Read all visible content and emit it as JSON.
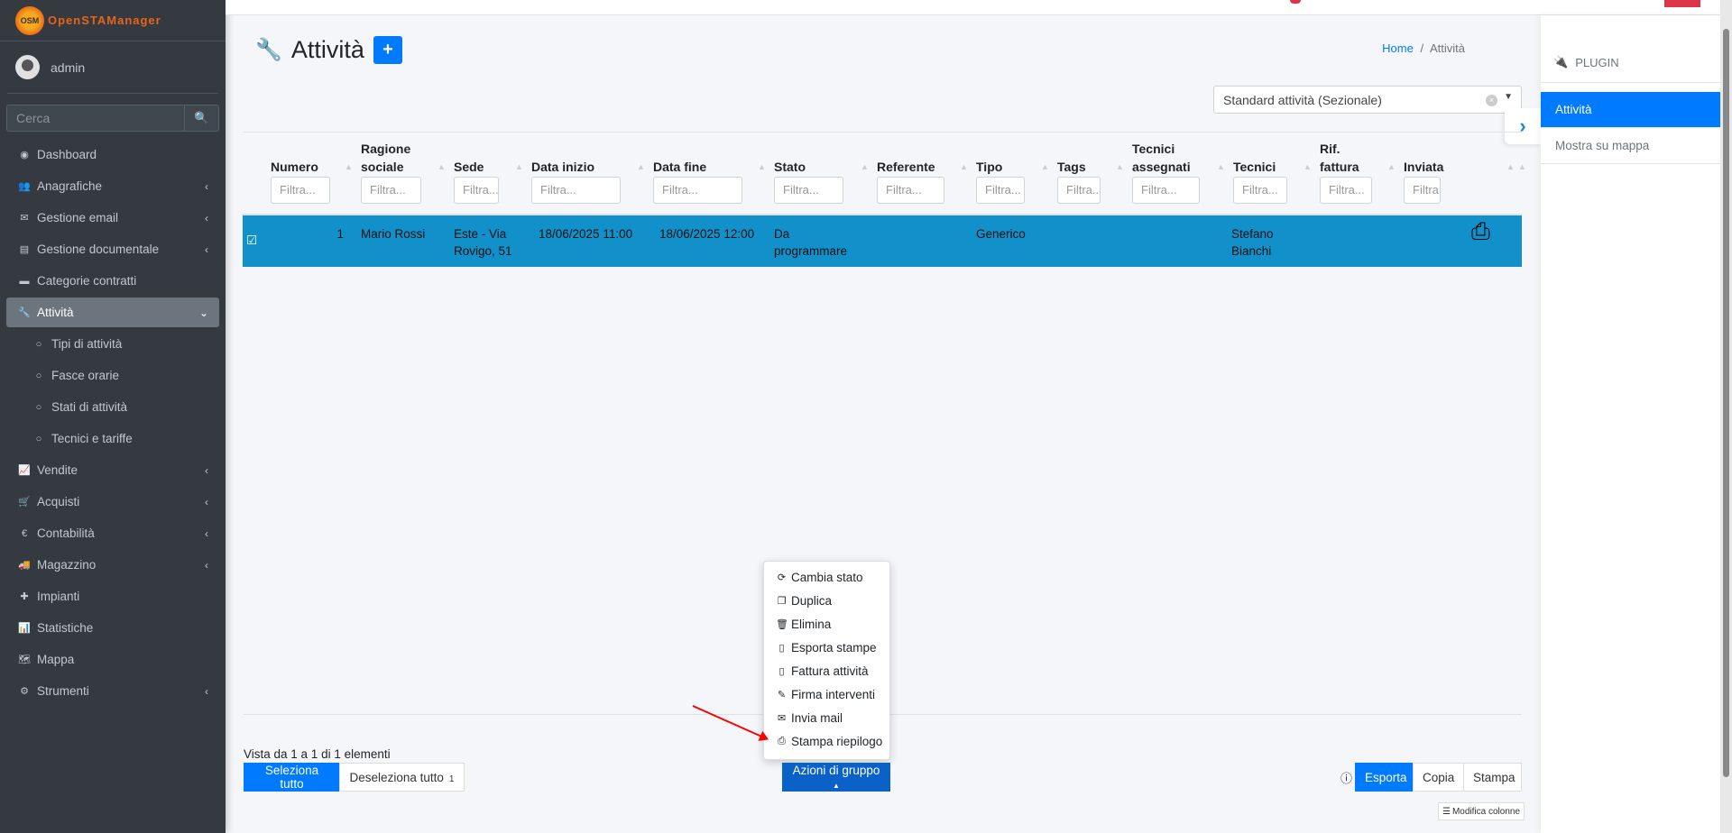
{
  "brand": {
    "name": "OpenSTAManager",
    "logo_text": "OSM"
  },
  "user": {
    "name": "admin"
  },
  "search": {
    "placeholder": "Cerca"
  },
  "sidebar": {
    "items": [
      {
        "label": "Dashboard",
        "icon": "dashboard-icon",
        "glyph": "◉",
        "arrow": false
      },
      {
        "label": "Anagrafiche",
        "icon": "users-icon",
        "glyph": "👥",
        "arrow": true
      },
      {
        "label": "Gestione email",
        "icon": "envelope-icon",
        "glyph": "✉",
        "arrow": true
      },
      {
        "label": "Gestione documentale",
        "icon": "file-icon",
        "glyph": "▤",
        "arrow": true
      },
      {
        "label": "Categorie contratti",
        "icon": "briefcase-icon",
        "glyph": "▬",
        "arrow": false
      },
      {
        "label": "Attività",
        "icon": "wrench-icon",
        "glyph": "🔧",
        "arrow": true,
        "active": true
      },
      {
        "label": "Tipi di attività",
        "icon": "circle-icon",
        "glyph": "○",
        "sub": true
      },
      {
        "label": "Fasce orarie",
        "icon": "circle-icon",
        "glyph": "○",
        "sub": true
      },
      {
        "label": "Stati di attività",
        "icon": "circle-icon",
        "glyph": "○",
        "sub": true
      },
      {
        "label": "Tecnici e tariffe",
        "icon": "circle-icon",
        "glyph": "○",
        "sub": true
      },
      {
        "label": "Vendite",
        "icon": "chart-line-icon",
        "glyph": "📈",
        "arrow": true
      },
      {
        "label": "Acquisti",
        "icon": "cart-icon",
        "glyph": "🛒",
        "arrow": true
      },
      {
        "label": "Contabilità",
        "icon": "euro-icon",
        "glyph": "€",
        "arrow": true
      },
      {
        "label": "Magazzino",
        "icon": "truck-icon",
        "glyph": "🚚",
        "arrow": true
      },
      {
        "label": "Impianti",
        "icon": "puzzle-icon",
        "glyph": "✚",
        "arrow": false
      },
      {
        "label": "Statistiche",
        "icon": "bar-chart-icon",
        "glyph": "📊",
        "arrow": false
      },
      {
        "label": "Mappa",
        "icon": "map-icon",
        "glyph": "🗺",
        "arrow": false
      },
      {
        "label": "Strumenti",
        "icon": "cog-icon",
        "glyph": "⚙",
        "arrow": true
      }
    ]
  },
  "page": {
    "title": "Attività",
    "add_label": "+"
  },
  "breadcrumb": {
    "home": "Home",
    "separator": "/",
    "current": "Attività"
  },
  "segment_select": {
    "value": "Standard attività (Sezionale)"
  },
  "table": {
    "filter_placeholder": "Filtra...",
    "columns": [
      {
        "l1": "",
        "l2": "Numero"
      },
      {
        "l1": "Ragione",
        "l2": "sociale"
      },
      {
        "l1": "",
        "l2": "Sede"
      },
      {
        "l1": "",
        "l2": "Data inizio"
      },
      {
        "l1": "",
        "l2": "Data fine"
      },
      {
        "l1": "",
        "l2": "Stato"
      },
      {
        "l1": "",
        "l2": "Referente"
      },
      {
        "l1": "",
        "l2": "Tipo"
      },
      {
        "l1": "",
        "l2": "Tags"
      },
      {
        "l1": "Tecnici",
        "l2": "assegnati"
      },
      {
        "l1": "",
        "l2": "Tecnici"
      },
      {
        "l1": "Rif.",
        "l2": "fattura"
      },
      {
        "l1": "",
        "l2": "Inviata"
      }
    ],
    "rows": [
      {
        "selected": true,
        "numero": "1",
        "ragione_sociale": "Mario Rossi",
        "sede": "Este - Via Rovigo, 51",
        "data_inizio": "18/06/2025 11:00",
        "data_fine": "18/06/2025 12:00",
        "stato": "Da programmare",
        "referente": "",
        "tipo": "Generico",
        "tags": "",
        "tecnici_assegnati": "",
        "tecnici": "Stefano Bianchi",
        "rif_fattura": "",
        "inviata": ""
      }
    ]
  },
  "right_panel": {
    "header": "PLUGIN",
    "items": [
      {
        "label": "Attività",
        "active": true
      },
      {
        "label": "Mostra su mappa"
      }
    ]
  },
  "group_actions": {
    "button": "Azioni di gruppo",
    "items": [
      {
        "label": "Cambia stato",
        "icon": "refresh-icon",
        "glyph": "⟳"
      },
      {
        "label": "Duplica",
        "icon": "copy-icon",
        "glyph": "❐"
      },
      {
        "label": "Elimina",
        "icon": "trash-icon",
        "glyph": "🗑"
      },
      {
        "label": "Esporta stampe",
        "icon": "file-export-icon",
        "glyph": "▯"
      },
      {
        "label": "Fattura attività",
        "icon": "file-code-icon",
        "glyph": "▯"
      },
      {
        "label": "Firma interventi",
        "icon": "pencil-icon",
        "glyph": "✎"
      },
      {
        "label": "Invia mail",
        "icon": "envelope-icon",
        "glyph": "✉"
      },
      {
        "label": "Stampa riepilogo",
        "icon": "print-icon",
        "glyph": "⎙"
      }
    ]
  },
  "footer": {
    "info": "Vista da 1 a 1 di 1 elementi",
    "select_all": "Seleziona tutto",
    "deselect_all": "Deseleziona tutto",
    "selected_count": "1",
    "export": "Esporta",
    "copy": "Copia",
    "print": "Stampa",
    "edit_columns": "Modifica colonne"
  },
  "colors": {
    "accent": "#007bff",
    "selected_row": "#1290c9",
    "sidebar": "#343a40"
  }
}
